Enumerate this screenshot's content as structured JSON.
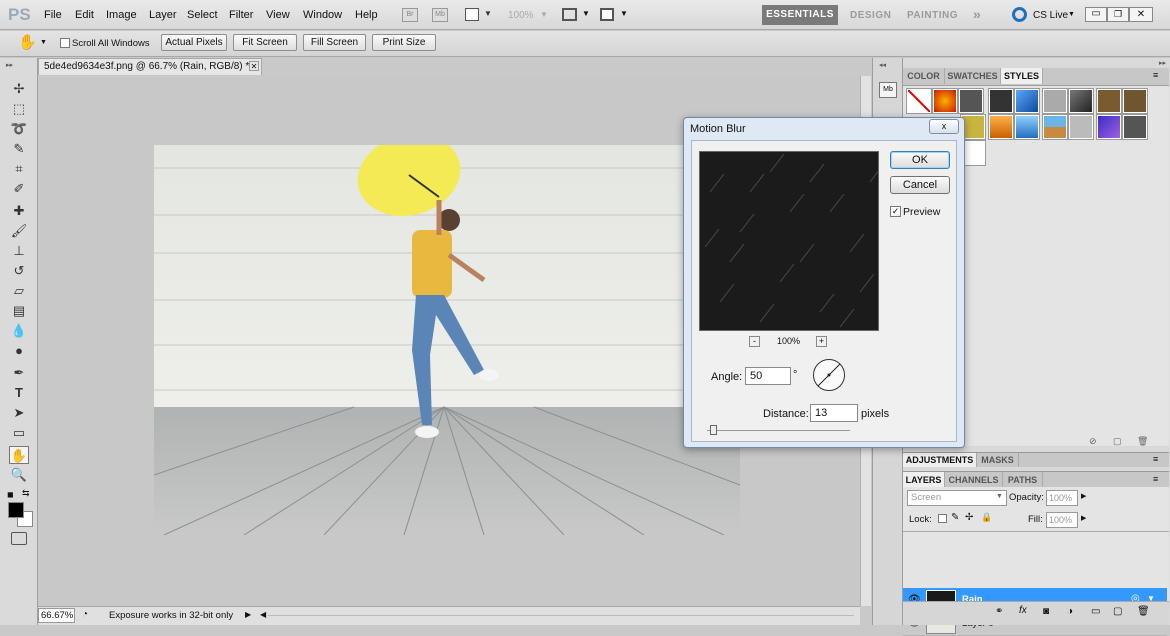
{
  "app": {
    "logo": "PS"
  },
  "menu": [
    "File",
    "Edit",
    "Image",
    "Layer",
    "Select",
    "Filter",
    "View",
    "Window",
    "Help"
  ],
  "menubar": {
    "br_label": "Br",
    "mb_label": "Mb",
    "zoom": "100%",
    "workspaces": {
      "active": "ESSENTIALS",
      "others": [
        "DESIGN",
        "PAINTING"
      ],
      "more": "»"
    },
    "cslive": "CS Live"
  },
  "options": {
    "scroll_all": "Scroll All Windows",
    "buttons": [
      "Actual Pixels",
      "Fit Screen",
      "Fill Screen",
      "Print Size"
    ]
  },
  "document": {
    "tab_title": "5de4ed9634e3f.png @ 66.7% (Rain, RGB/8) *",
    "zoom": "66.67%",
    "status": "Exposure works in 32-bit only"
  },
  "panels": {
    "top_tabs": [
      "COLOR",
      "SWATCHES",
      "STYLES"
    ],
    "active_top": "STYLES",
    "adj_tabs": [
      "ADJUSTMENTS",
      "MASKS"
    ],
    "layer_tabs": [
      "LAYERS",
      "CHANNELS",
      "PATHS"
    ],
    "blend_mode": "Screen",
    "opacity_label": "Opacity:",
    "opacity": "100%",
    "lock_label": "Lock:",
    "fill_label": "Fill:",
    "fill": "100%",
    "layers": [
      {
        "name": "Rain",
        "selected": true
      },
      {
        "name": "Layer 0",
        "selected": false
      }
    ]
  },
  "dialog": {
    "title": "Motion Blur",
    "ok": "OK",
    "cancel": "Cancel",
    "preview_label": "Preview",
    "preview_checked": true,
    "zoom_minus": "-",
    "zoom": "100%",
    "zoom_plus": "+",
    "angle_label": "Angle:",
    "angle": "50",
    "angle_unit": "°",
    "distance_label": "Distance:",
    "distance": "13",
    "distance_unit": "pixels",
    "close": "x"
  },
  "colors": {
    "accent": "#3399ff",
    "ws_active": "#7a7a7a"
  }
}
